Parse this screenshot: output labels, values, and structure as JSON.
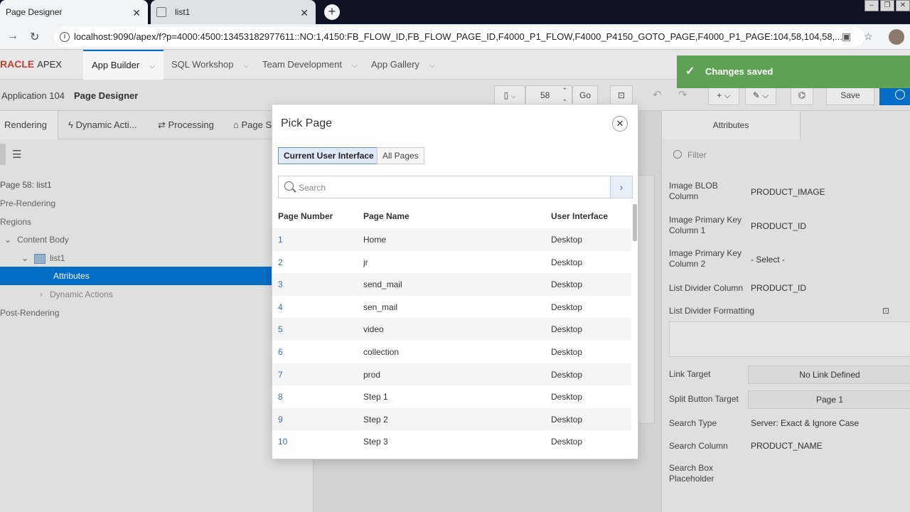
{
  "browser": {
    "tabs": [
      {
        "title": "Page Designer"
      },
      {
        "title": "list1"
      }
    ],
    "url": "localhost:9090/apex/f?p=4000:4500:13453182977611::NO:1,4150:FB_FLOW_ID,FB_FLOW_PAGE_ID,F4000_P1_FLOW,F4000_P4150_GOTO_PAGE,F4000_P1_PAGE:104,58,104,58,..."
  },
  "header": {
    "logo": "RACLE",
    "logo_suffix": "APEX",
    "tabs": [
      {
        "label": "App Builder"
      },
      {
        "label": "SQL Workshop"
      },
      {
        "label": "Team Development"
      },
      {
        "label": "App Gallery"
      }
    ]
  },
  "toolbar": {
    "breadcrumb_app": "Application 104",
    "breadcrumb_page": "Page Designer",
    "page_number": "58",
    "go_label": "Go",
    "save_label": "Save"
  },
  "left_panel": {
    "tabs": [
      {
        "label": "Rendering"
      },
      {
        "label": "Dynamic Acti..."
      },
      {
        "label": "Processing"
      },
      {
        "label": "Page S"
      }
    ],
    "tree": {
      "page": "Page 58: list1",
      "pre_rendering": "Pre-Rendering",
      "regions": "Regions",
      "content_body": "Content Body",
      "list1": "list1",
      "attributes": "Attributes",
      "dynamic_actions": "Dynamic Actions",
      "post_rendering": "Post-Rendering"
    }
  },
  "right_panel": {
    "tab": "Attributes",
    "filter_placeholder": "Filter",
    "rows": [
      {
        "label": "Image BLOB Column",
        "value": "PRODUCT_IMAGE"
      },
      {
        "label": "Image Primary Key Column 1",
        "value": "PRODUCT_ID"
      },
      {
        "label": "Image Primary Key Column 2",
        "value": "- Select -"
      },
      {
        "label": "List Divider Column",
        "value": "PRODUCT_ID"
      },
      {
        "label": "List Divider Formatting",
        "value": ""
      },
      {
        "label": "Link Target",
        "value": "No Link Defined"
      },
      {
        "label": "Split Button Target",
        "value": "Page 1"
      },
      {
        "label": "Search Type",
        "value": "Server: Exact & Ignore Case"
      },
      {
        "label": "Search Column",
        "value": "PRODUCT_NAME"
      },
      {
        "label": "Search Box Placeholder",
        "value": ""
      }
    ]
  },
  "modal": {
    "title": "Pick Page",
    "segments": [
      {
        "label": "Current User Interface"
      },
      {
        "label": "All Pages"
      }
    ],
    "search_placeholder": "Search",
    "columns": [
      "Page Number",
      "Page Name",
      "User Interface"
    ],
    "rows": [
      {
        "num": "1",
        "name": "Home",
        "ui": "Desktop"
      },
      {
        "num": "2",
        "name": "jr",
        "ui": "Desktop"
      },
      {
        "num": "3",
        "name": "send_mail",
        "ui": "Desktop"
      },
      {
        "num": "4",
        "name": "sen_mail",
        "ui": "Desktop"
      },
      {
        "num": "5",
        "name": "video",
        "ui": "Desktop"
      },
      {
        "num": "6",
        "name": "collection",
        "ui": "Desktop"
      },
      {
        "num": "7",
        "name": "prod",
        "ui": "Desktop"
      },
      {
        "num": "8",
        "name": "Step 1",
        "ui": "Desktop"
      },
      {
        "num": "9",
        "name": "Step 2",
        "ui": "Desktop"
      },
      {
        "num": "10",
        "name": "Step 3",
        "ui": "Desktop"
      }
    ]
  },
  "toast": {
    "message": "Changes saved"
  },
  "colors": {
    "accent": "#0572ce",
    "toast": "#5ea154",
    "brand": "#c74634"
  }
}
